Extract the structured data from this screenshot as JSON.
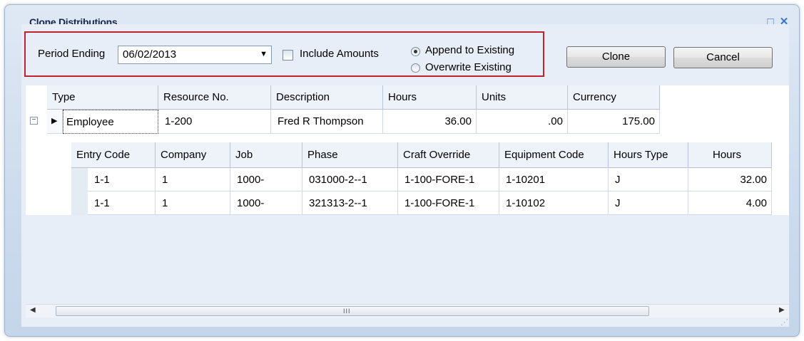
{
  "window": {
    "title": "Clone Distributions"
  },
  "filters": {
    "period_ending_label": "Period Ending",
    "period_ending_value": "06/02/2013",
    "include_amounts_label": "Include Amounts",
    "include_amounts_checked": false,
    "append_label": "Append to Existing",
    "overwrite_label": "Overwrite Existing",
    "selected_option": "Append to Existing"
  },
  "buttons": {
    "clone": "Clone",
    "cancel": "Cancel"
  },
  "parent_grid": {
    "columns": [
      "Type",
      "Resource No.",
      "Description",
      "Hours",
      "Units",
      "Currency"
    ],
    "row": {
      "type": "Employee",
      "resource_no": "1-200",
      "description": "Fred R Thompson",
      "hours": "36.00",
      "units": ".00",
      "currency": "175.00"
    }
  },
  "child_grid": {
    "columns": [
      "Entry Code",
      "Company",
      "Job",
      "Phase",
      "Craft Override",
      "Equipment Code",
      "Hours Type",
      "Hours"
    ],
    "rows": [
      [
        "1-1",
        "1",
        "1000-",
        "031000-2--1",
        "1-100-FORE-1",
        "1-10201",
        "J",
        "32.00"
      ],
      [
        "1-1",
        "1",
        "1000-",
        "321313-2--1",
        "1-100-FORE-1",
        "1-10102",
        "J",
        "4.00"
      ]
    ]
  },
  "scrollbar": {
    "grip": "III"
  },
  "icons": {
    "minimize": "minimize-icon",
    "maximize": "maximize-icon",
    "close": "close-icon",
    "dropdown": "chevron-down-icon",
    "collapse": "collapse-minus-icon",
    "row_pointer": "row-pointer-icon"
  },
  "colors": {
    "highlight_border": "#c0252f",
    "panel_background": "#e7eef8",
    "title_text": "#15274a"
  }
}
